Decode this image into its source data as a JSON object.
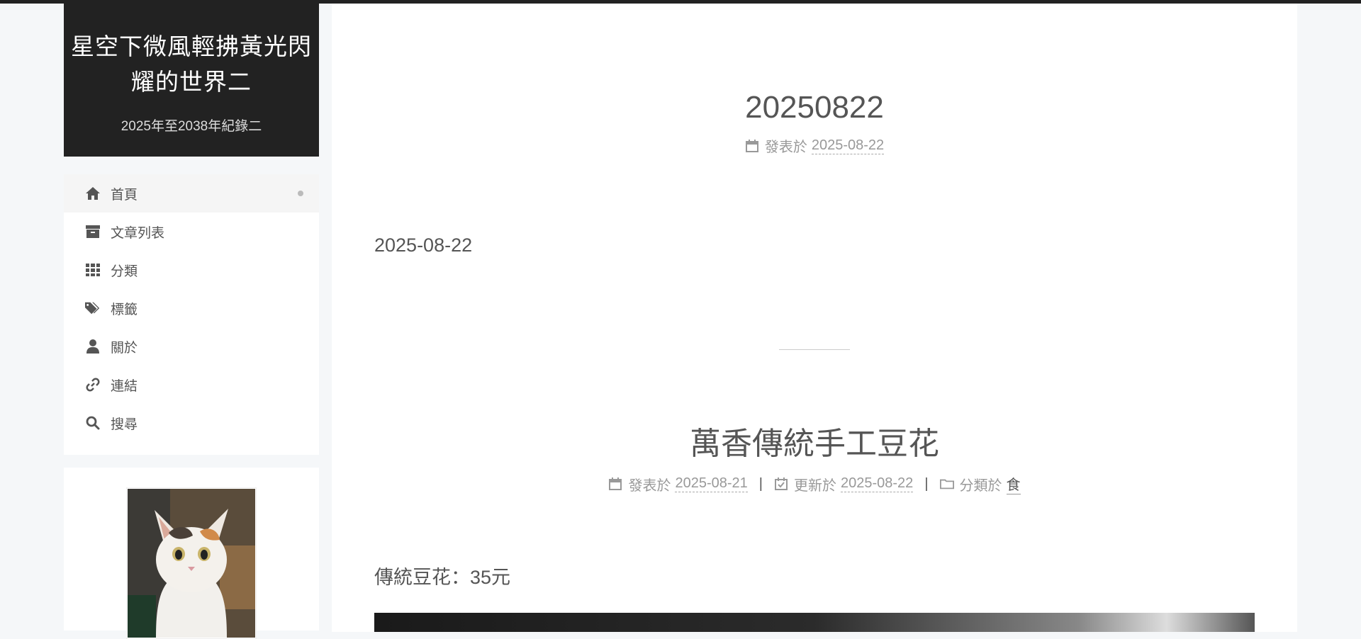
{
  "site": {
    "title": "星空下微風輕拂黃光閃耀的世界二",
    "subtitle": "2025年至2038年紀錄二"
  },
  "menu": [
    {
      "label": "首頁",
      "icon": "home-icon",
      "active": true
    },
    {
      "label": "文章列表",
      "icon": "archive-icon"
    },
    {
      "label": "分類",
      "icon": "grid-icon"
    },
    {
      "label": "標籤",
      "icon": "tags-icon"
    },
    {
      "label": "關於",
      "icon": "user-icon"
    },
    {
      "label": "連結",
      "icon": "link-icon"
    },
    {
      "label": "搜尋",
      "icon": "search-icon"
    }
  ],
  "posts": [
    {
      "title": "20250822",
      "posted_label": "發表於",
      "posted_date": "2025-08-22",
      "body": "2025-08-22"
    },
    {
      "title": "萬香傳統手工豆花",
      "posted_label": "發表於",
      "posted_date": "2025-08-21",
      "sep1": "|",
      "updated_label": "更新於",
      "updated_date": "2025-08-22",
      "sep2": "|",
      "category_label": "分類於",
      "category": "食",
      "body": "傳統豆花：35元"
    }
  ],
  "colors": {
    "brand_bg": "#222222",
    "page_bg": "#f5f7f9",
    "text": "#555555",
    "meta": "#999999"
  }
}
